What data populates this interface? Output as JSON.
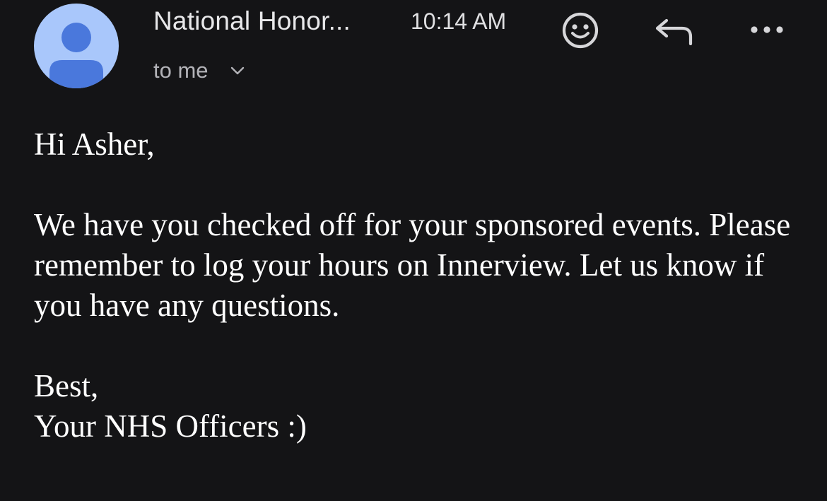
{
  "email": {
    "sender": "National Honor...",
    "time": "10:14 AM",
    "recipient": "to me",
    "icons": {
      "avatar": "person-avatar-icon",
      "emoji": "emoji-smile-icon",
      "reply": "reply-arrow-icon",
      "more": "more-horizontal-icon",
      "expand": "chevron-down-icon"
    },
    "colors": {
      "background": "#141416",
      "avatar_bg": "#a9c7fb",
      "avatar_fg": "#4a78dc"
    },
    "body": {
      "greeting": "Hi Asher,",
      "paragraph": "We have you checked off for your sponsored events. Please remember to log your hours on Innerview. Let us know if you have any questions.",
      "closing": "Best,",
      "signature": "Your NHS Officers :)"
    }
  }
}
